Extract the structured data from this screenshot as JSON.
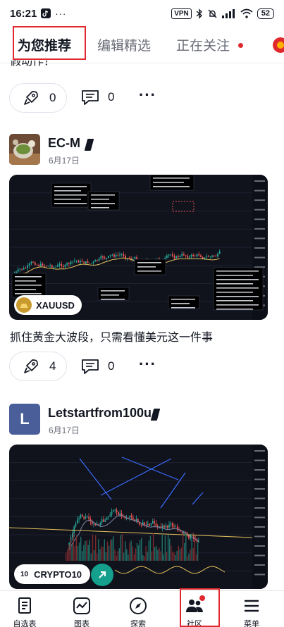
{
  "status_bar": {
    "time": "16:21",
    "dots": "···",
    "vpn": "VPN",
    "battery": "52"
  },
  "tabs": [
    {
      "label": "为您推荐",
      "active": true
    },
    {
      "label": "编辑精选",
      "active": false
    },
    {
      "label": "正在关注",
      "active": false
    }
  ],
  "prev_post": {
    "cut_title": "假动作？",
    "boosts": "0",
    "comments": "0"
  },
  "posts": [
    {
      "author": "EC-M",
      "date": "6月17日",
      "symbol": "XAUUSD",
      "title": "抓住黄金大波段，只需看懂美元这一件事",
      "boosts": "4",
      "comments": "0"
    },
    {
      "author": "Letstartfrom100u",
      "avatar_letter": "L",
      "date": "6月17日",
      "symbol": "CRYPTO10",
      "symbol_prefix": "10"
    }
  ],
  "bottom_nav": [
    {
      "label": "自选表",
      "icon": "watchlist-icon"
    },
    {
      "label": "图表",
      "icon": "chart-icon"
    },
    {
      "label": "探索",
      "icon": "compass-icon"
    },
    {
      "label": "社区",
      "icon": "community-icon"
    },
    {
      "label": "菜单",
      "icon": "menu-icon"
    }
  ],
  "colors": {
    "accent_red": "#e0292e",
    "text": "#131722",
    "muted": "#6a6d78",
    "chart_bg": "#10131c",
    "up": "#26a69a",
    "down": "#ef5350"
  }
}
